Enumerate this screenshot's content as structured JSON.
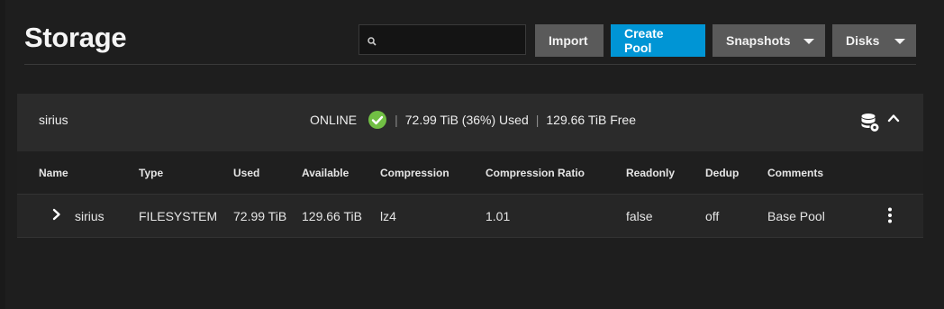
{
  "page": {
    "title": "Storage"
  },
  "header": {
    "search": {
      "placeholder": "",
      "value": ""
    },
    "buttons": {
      "import": "Import",
      "create_pool": "Create Pool",
      "snapshots": "Snapshots",
      "disks": "Disks"
    }
  },
  "pool": {
    "name": "sirius",
    "status": "ONLINE",
    "used": "72.99 TiB (36%) Used",
    "free": "129.66 TiB Free",
    "icons": {
      "status": "check-circle-icon",
      "settings": "database-gear-icon",
      "collapse": "chevron-up-icon"
    }
  },
  "table": {
    "columns": [
      "Name",
      "Type",
      "Used",
      "Available",
      "Compression",
      "Compression Ratio",
      "Readonly",
      "Dedup",
      "Comments"
    ],
    "rows": [
      {
        "name": "sirius",
        "type": "FILESYSTEM",
        "used": "72.99 TiB",
        "available": "129.66 TiB",
        "compression": "lz4",
        "compression_ratio": "1.01",
        "readonly": "false",
        "dedup": "off",
        "comments": "Base Pool"
      }
    ]
  },
  "colors": {
    "background": "#1e1e1e",
    "card": "#262626",
    "primary": "#0095d5",
    "success": "#71bf44",
    "button": "#5a5a5a"
  }
}
